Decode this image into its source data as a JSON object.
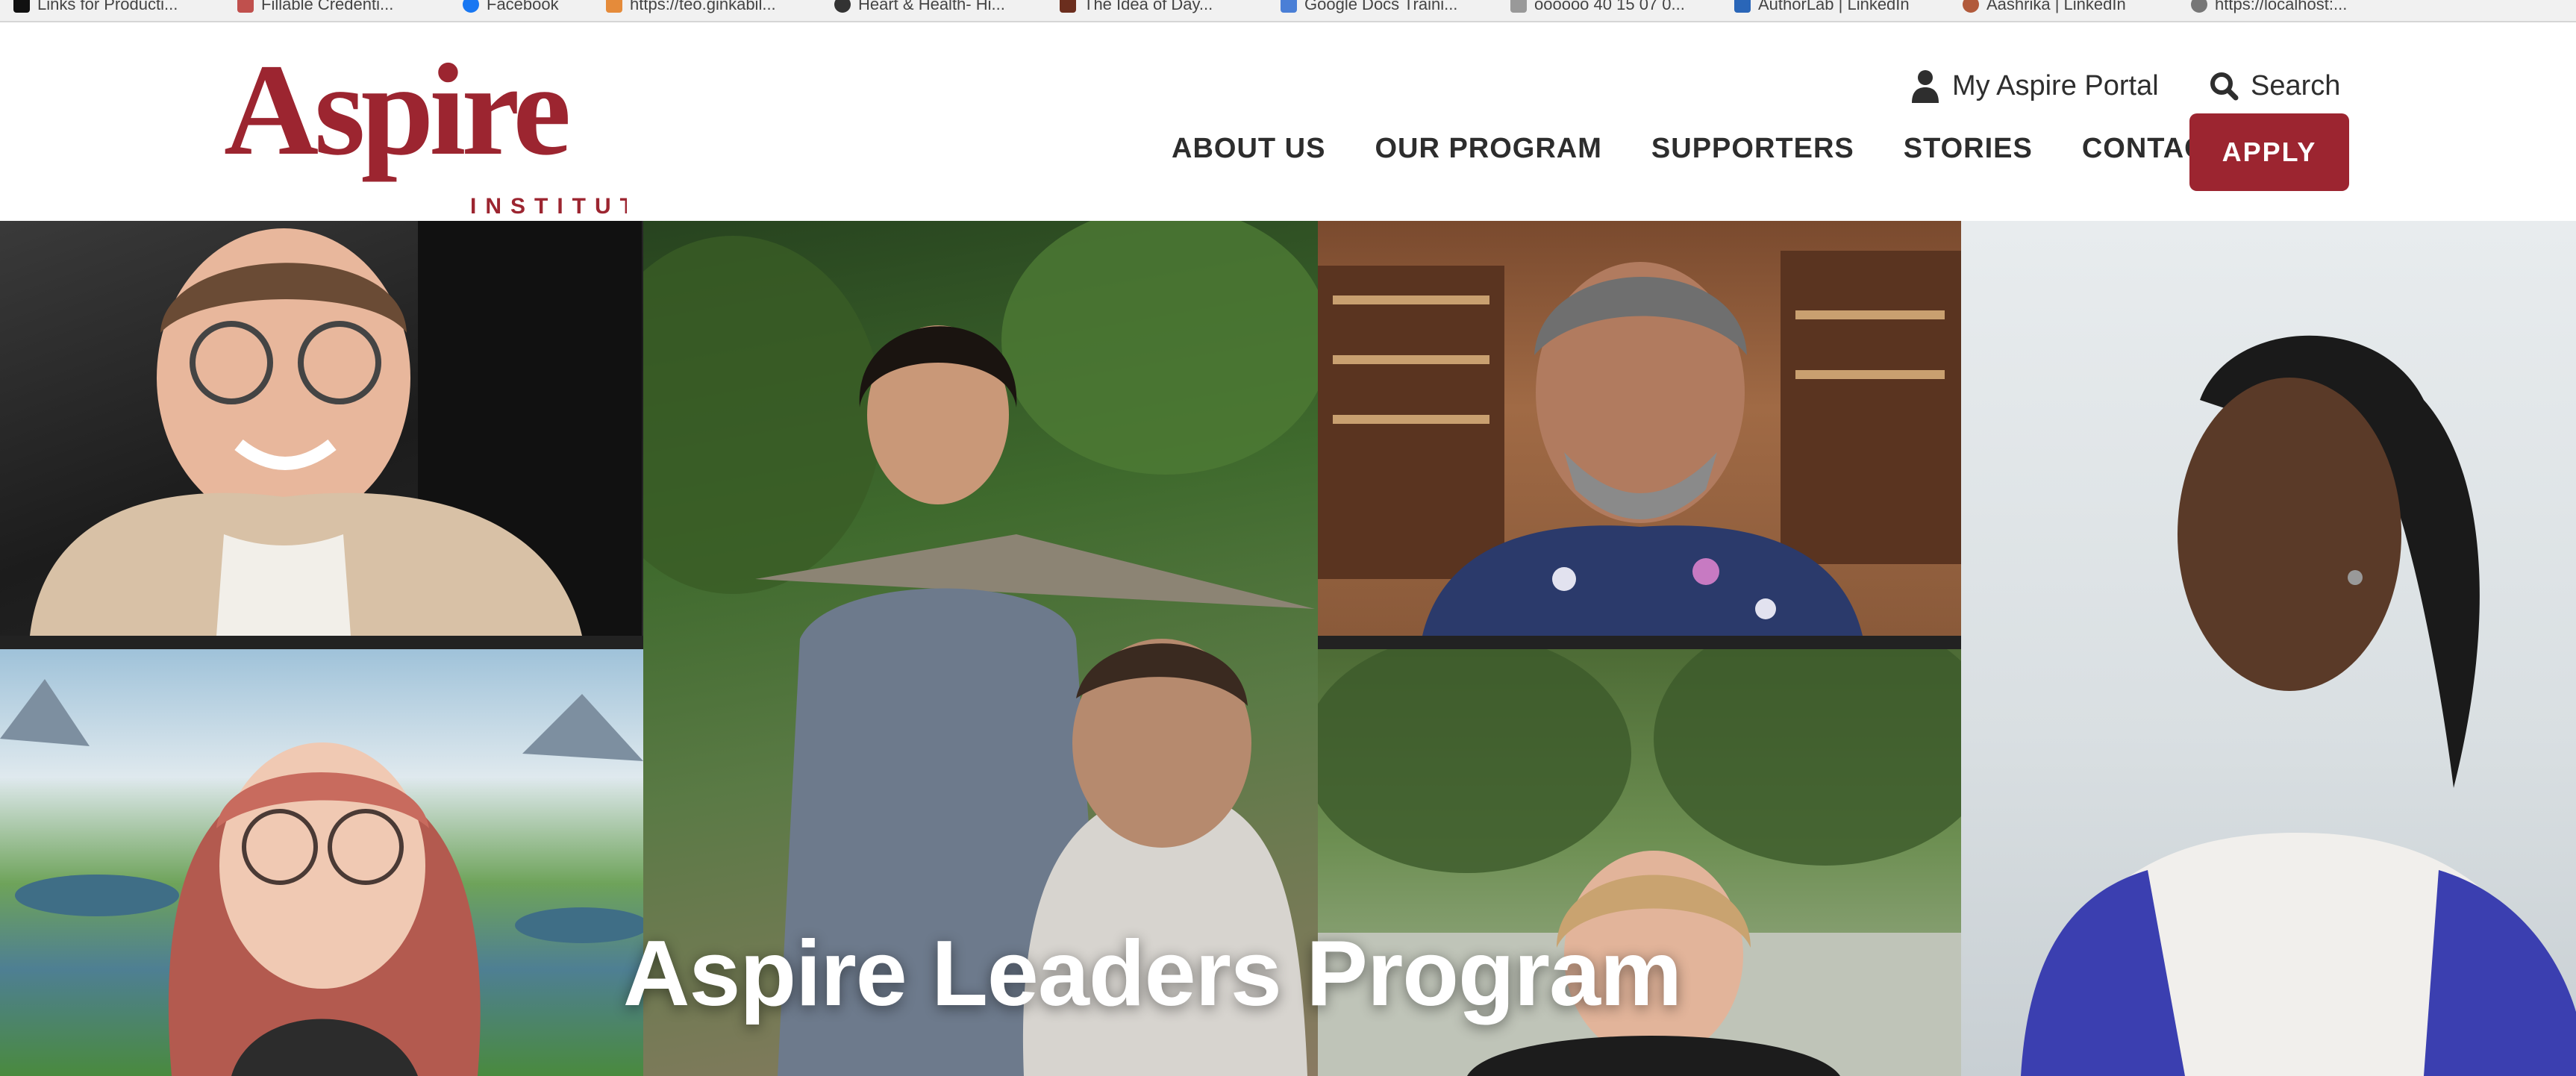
{
  "bookmarks": [
    {
      "label": "Links for Producti...",
      "color": "#111111",
      "icon": "bookmark-favicon-icon"
    },
    {
      "label": "Fillable Credenti...",
      "color": "#c0504d",
      "icon": "bookmark-favicon-icon"
    },
    {
      "label": "Facebook",
      "color": "#1877f2",
      "icon": "facebook-icon"
    },
    {
      "label": "https://teo.ginkabil...",
      "color": "#e58b3a",
      "icon": "bookmark-favicon-icon"
    },
    {
      "label": "Heart & Health- Hi...",
      "color": "#333333",
      "icon": "github-icon"
    },
    {
      "label": "The Idea of Day...",
      "color": "#6b2e1e",
      "icon": "bookmark-favicon-icon"
    },
    {
      "label": "Google Docs Traini...",
      "color": "#4a7fd6",
      "icon": "google-docs-icon"
    },
    {
      "label": "oooooo 40 15 07 0...",
      "color": "#888888",
      "icon": "document-icon"
    },
    {
      "label": "AuthorLab | LinkedIn",
      "color": "#2a66b8",
      "icon": "linkedin-icon"
    },
    {
      "label": "Aashrika | LinkedIn",
      "color": "#b15a3b",
      "icon": "avatar-icon"
    },
    {
      "label": "https://localhost:...",
      "color": "#777777",
      "icon": "globe-icon"
    }
  ],
  "brand": {
    "name": "Aspire",
    "sub": "INSTITUTE",
    "color": "#9c2530"
  },
  "util_nav": {
    "portal_label": "My Aspire Portal",
    "search_label": "Search"
  },
  "nav": {
    "items": [
      "ABOUT US",
      "OUR PROGRAM",
      "SUPPORTERS",
      "STORIES",
      "CONTACT"
    ],
    "apply_label": "APPLY"
  },
  "hero": {
    "title": "Aspire Leaders Program"
  }
}
